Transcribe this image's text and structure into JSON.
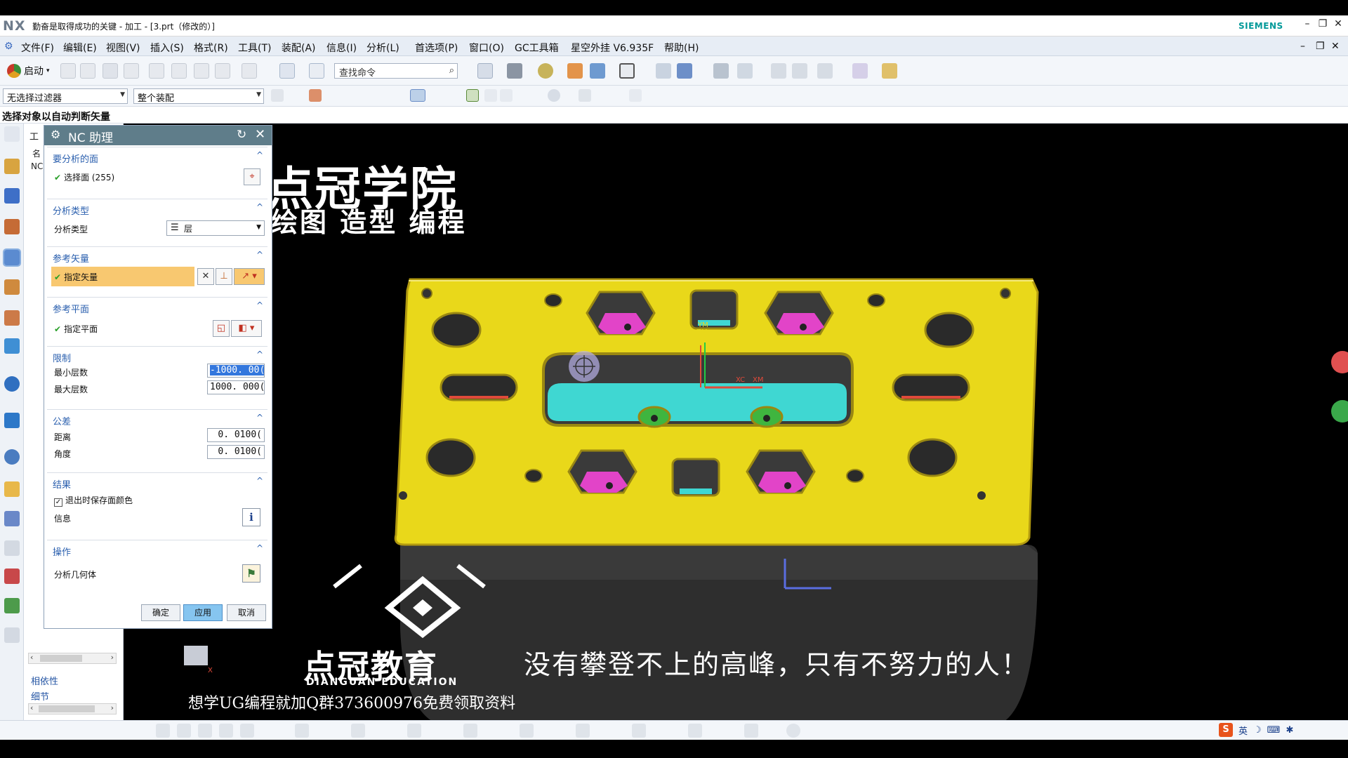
{
  "window": {
    "logo": "NX",
    "title": "勤奋是取得成功的关键 - 加工 - [3.prt（修改的）]",
    "brand": "SIEMENS"
  },
  "menu": [
    "文件(F)",
    "编辑(E)",
    "视图(V)",
    "插入(S)",
    "格式(R)",
    "工具(T)",
    "装配(A)",
    "信息(I)",
    "分析(L)",
    "首选项(P)",
    "窗口(O)",
    "GC工具箱",
    "星空外挂 V6.935F",
    "帮助(H)"
  ],
  "toolbar": {
    "start_label": "启动",
    "search_placeholder": "查找命令",
    "filter_value": "无选择过滤器",
    "scope_value": "整个装配"
  },
  "status_prompt": "选择对象以自动判断矢量",
  "nav": {
    "link1": "相依性",
    "link2": "细节",
    "tab_peek1": "工",
    "tab_peek2": "名",
    "tab_peek3": "NC"
  },
  "dialog": {
    "title": "NC 助理",
    "sec_faces": "要分析的面",
    "select_faces": "选择面 (255)",
    "sec_type": "分析类型",
    "type_label": "分析类型",
    "type_value": "层",
    "sec_ref_vector": "参考矢量",
    "specify_vector": "指定矢量",
    "sec_ref_plane": "参考平面",
    "specify_plane": "指定平面",
    "sec_limits": "限制",
    "min_layer_label": "最小层数",
    "min_layer_value": "-1000. 00(",
    "max_layer_label": "最大层数",
    "max_layer_value": "1000. 000(",
    "sec_tolerance": "公差",
    "distance_label": "距离",
    "distance_value": "0. 0100(",
    "angle_label": "角度",
    "angle_value": "0. 0100(",
    "sec_result": "结果",
    "save_color_label": "退出时保存面颜色",
    "info_label": "信息",
    "sec_operation": "操作",
    "analyze_geom_label": "分析几何体",
    "ok": "确定",
    "apply": "应用",
    "cancel": "取消"
  },
  "overlay": {
    "title": "点冠学院",
    "subtitle": "绘图 造型 编程",
    "brand_cn": "点冠教育",
    "brand_en": "DIANGUAN EDUCATION",
    "slogan": "没有攀登不上的高峰，只有不努力的人！",
    "promo": "想学UG编程就加Q群373600976免费领取资料"
  },
  "axes": {
    "zm": "ZM",
    "ym": "YM",
    "xc": "XC",
    "xm": "XM"
  },
  "ime": {
    "s": "S",
    "lang": "英"
  },
  "colors": {
    "part_top": "#e9d81a",
    "part_side": "#2b2b2b",
    "pocket_cyan": "#3fd7d2",
    "pocket_magenta": "#e244c8",
    "hole_green": "#3fb53f",
    "dialog_title": "#5f7d8a",
    "highlight": "#f8c870"
  }
}
